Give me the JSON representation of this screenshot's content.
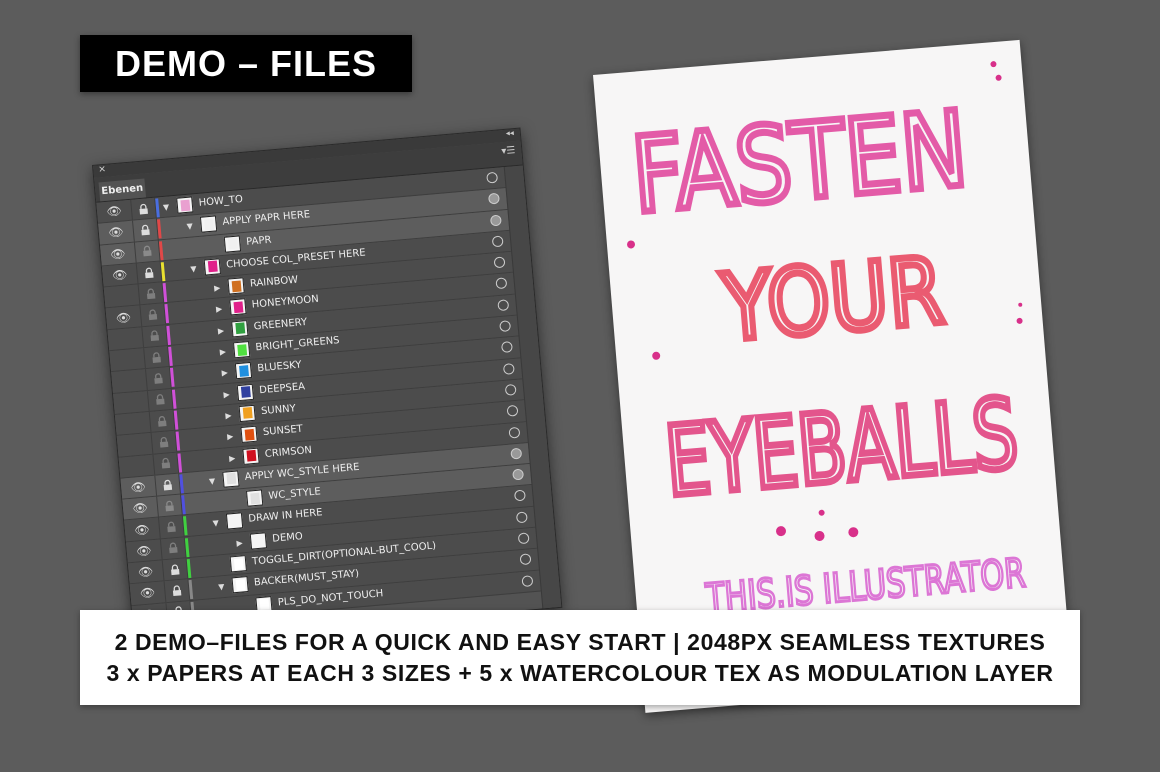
{
  "title": "DEMO – FILES",
  "panel": {
    "tab_label": "Ebenen",
    "close_icon": "close-icon",
    "collapse_icon": "double-chevron-left-icon",
    "menu_icon": "panel-menu-icon",
    "layers": [
      {
        "name": "HOW_TO",
        "depth": 0,
        "expander": "down",
        "color": "#4a6ee0",
        "visible": true,
        "lock": "on",
        "thumb": "#e9a0d0",
        "target": "empty",
        "selected": false
      },
      {
        "name": "APPLY PAPR HERE",
        "depth": 1,
        "expander": "down",
        "color": "#e04848",
        "visible": true,
        "lock": "on",
        "thumb": "#f0f0f0",
        "target": "filled",
        "selected": true
      },
      {
        "name": "PAPR",
        "depth": 2,
        "expander": "none",
        "color": "#e04848",
        "visible": true,
        "lock": "dim",
        "thumb": "#f0f0f0",
        "target": "filled",
        "selected": true
      },
      {
        "name": "CHOOSE COL_PRESET HERE",
        "depth": 1,
        "expander": "down",
        "color": "#e8e030",
        "visible": true,
        "lock": "on",
        "thumb": "#e0208a",
        "target": "empty",
        "selected": false
      },
      {
        "name": "RAINBOW",
        "depth": 2,
        "expander": "right",
        "color": "#d050d8",
        "visible": false,
        "lock": "dim",
        "thumb": "#d07020",
        "target": "empty",
        "selected": false
      },
      {
        "name": "HONEYMOON",
        "depth": 2,
        "expander": "right",
        "color": "#d050d8",
        "visible": true,
        "lock": "dim",
        "thumb": "#e0208a",
        "target": "empty",
        "selected": false
      },
      {
        "name": "GREENERY",
        "depth": 2,
        "expander": "right",
        "color": "#d050d8",
        "visible": false,
        "lock": "dim",
        "thumb": "#30a040",
        "target": "empty",
        "selected": false
      },
      {
        "name": "BRIGHT_GREENS",
        "depth": 2,
        "expander": "right",
        "color": "#d050d8",
        "visible": false,
        "lock": "dim",
        "thumb": "#50e040",
        "target": "empty",
        "selected": false
      },
      {
        "name": "BLUESKY",
        "depth": 2,
        "expander": "right",
        "color": "#d050d8",
        "visible": false,
        "lock": "dim",
        "thumb": "#2090e0",
        "target": "empty",
        "selected": false
      },
      {
        "name": "DEEPSEA",
        "depth": 2,
        "expander": "right",
        "color": "#d050d8",
        "visible": false,
        "lock": "dim",
        "thumb": "#3040a0",
        "target": "empty",
        "selected": false
      },
      {
        "name": "SUNNY",
        "depth": 2,
        "expander": "right",
        "color": "#d050d8",
        "visible": false,
        "lock": "dim",
        "thumb": "#f0a020",
        "target": "empty",
        "selected": false
      },
      {
        "name": "SUNSET",
        "depth": 2,
        "expander": "right",
        "color": "#d050d8",
        "visible": false,
        "lock": "dim",
        "thumb": "#e05010",
        "target": "empty",
        "selected": false
      },
      {
        "name": "CRIMSON",
        "depth": 2,
        "expander": "right",
        "color": "#d050d8",
        "visible": false,
        "lock": "dim",
        "thumb": "#d01020",
        "target": "empty",
        "selected": false
      },
      {
        "name": "APPLY WC_STYLE HERE",
        "depth": 1,
        "expander": "down",
        "color": "#5050e0",
        "visible": true,
        "lock": "on",
        "thumb": "#e0e0e0",
        "target": "filled",
        "selected": true
      },
      {
        "name": "WC_STYLE",
        "depth": 2,
        "expander": "none",
        "color": "#5050e0",
        "visible": true,
        "lock": "dim",
        "thumb": "#e0e0e0",
        "target": "filled",
        "selected": true
      },
      {
        "name": "DRAW IN HERE",
        "depth": 1,
        "expander": "down",
        "color": "#40d040",
        "visible": true,
        "lock": "dim",
        "thumb": "#f4f4f4",
        "target": "empty",
        "selected": false
      },
      {
        "name": "DEMO",
        "depth": 2,
        "expander": "right",
        "color": "#40d040",
        "visible": true,
        "lock": "dim",
        "thumb": "#f4f4f4",
        "target": "empty",
        "selected": false
      },
      {
        "name": "TOGGLE_DIRT(OPTIONAL-BUT_COOL)",
        "depth": 1,
        "expander": "none",
        "color": "#40d040",
        "visible": true,
        "lock": "on",
        "thumb": "#ffffff",
        "target": "empty",
        "selected": false
      },
      {
        "name": "BACKER(MUST_STAY)",
        "depth": 1,
        "expander": "down",
        "color": "#888888",
        "visible": true,
        "lock": "on",
        "thumb": "#ffffff",
        "target": "empty",
        "selected": false
      },
      {
        "name": "PLS_DO_NOT_TOUCH",
        "depth": 2,
        "expander": "none",
        "color": "#888888",
        "visible": true,
        "lock": "on",
        "thumb": "#ffffff",
        "target": "empty",
        "selected": false
      }
    ]
  },
  "artwork": {
    "lines": [
      "FASTEN",
      "YOUR",
      "EYEBALLS"
    ],
    "footer": "THIS.IS ILLUSTRATOR",
    "ink_colors": [
      "#e0409a",
      "#e8405a",
      "#e03a7a",
      "#d860d0"
    ]
  },
  "banner": {
    "line1": "2 DEMO–FILES FOR A QUICK AND EASY START | 2048PX SEAMLESS TEXTURES",
    "line2": "3 x PAPERS AT EACH 3 SIZES + 5 x WATERCOLOUR TEX AS MODULATION LAYER"
  }
}
